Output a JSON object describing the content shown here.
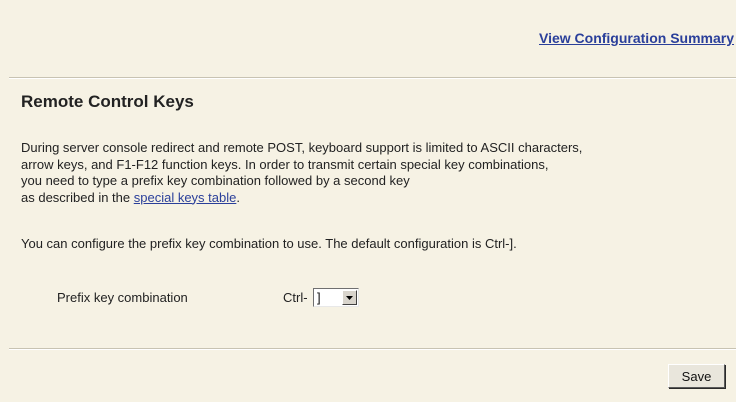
{
  "header": {
    "summary_link": "View Configuration Summary"
  },
  "section": {
    "title": "Remote Control Keys",
    "description": {
      "line1": "During server console redirect and remote POST, keyboard support is limited to ASCII characters,",
      "line2": "arrow keys, and F1-F12 function keys. In order to transmit certain special key combinations,",
      "line3": "you need to type a prefix key combination followed by a second key",
      "line4_prefix": "as described in the ",
      "line4_link": "special keys table",
      "line4_suffix": "."
    },
    "note": "You can configure the prefix key combination to use. The default configuration is Ctrl-]."
  },
  "form": {
    "prefix_label": "Prefix key combination",
    "ctrl_label": "Ctrl-",
    "selected_key": "]"
  },
  "actions": {
    "save_label": "Save"
  }
}
